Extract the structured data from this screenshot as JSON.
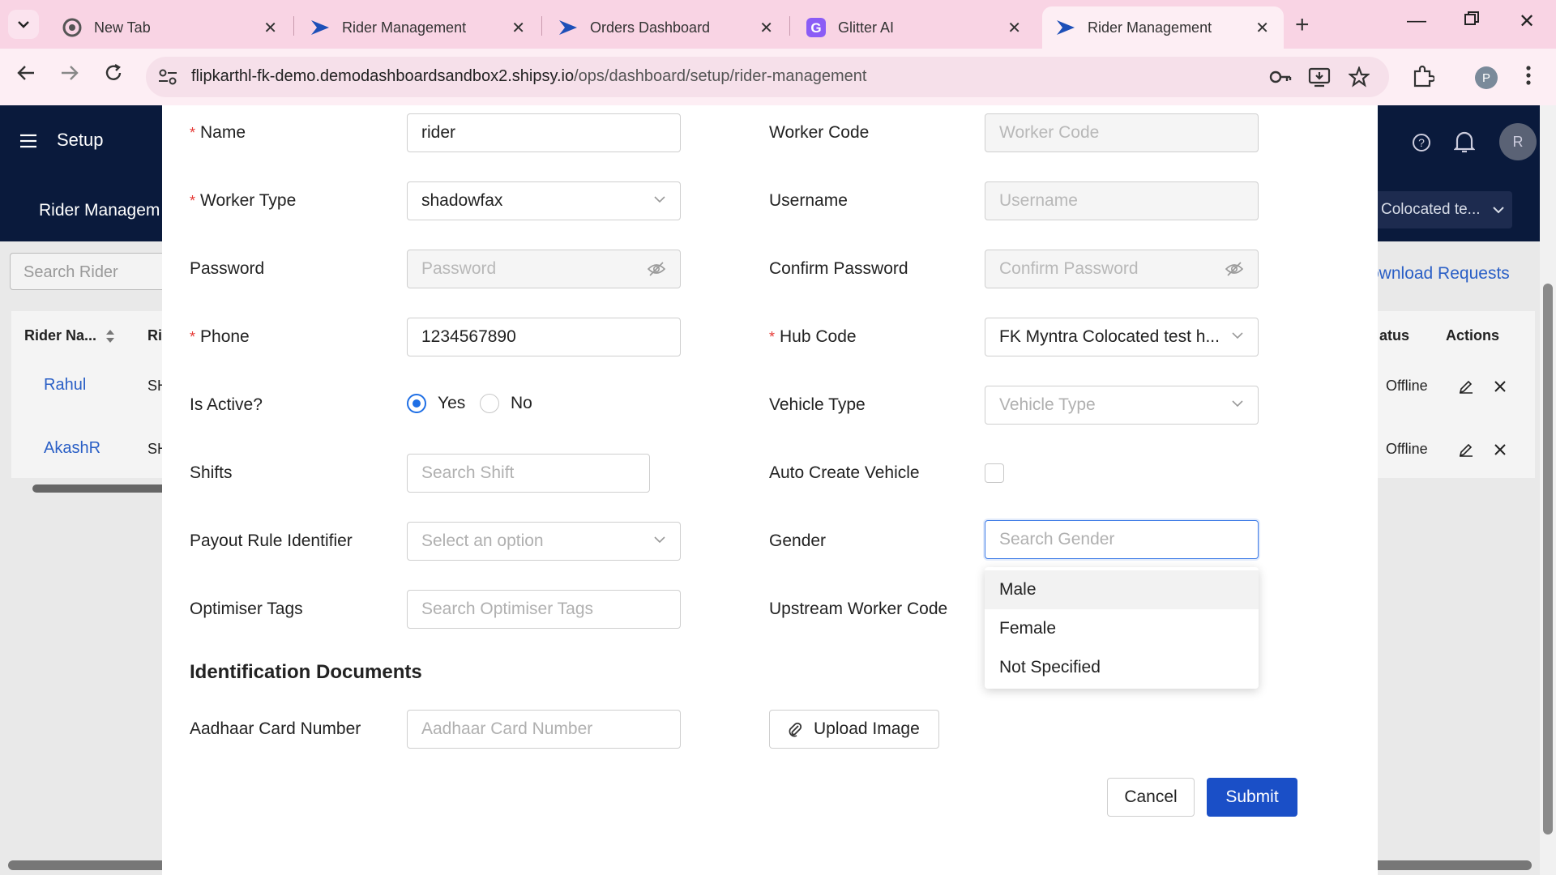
{
  "browser": {
    "tabs": [
      {
        "title": "New Tab",
        "icon": "chrome-icon"
      },
      {
        "title": "Rider Management",
        "icon": "shipsy-icon"
      },
      {
        "title": "Orders Dashboard",
        "icon": "shipsy-icon"
      },
      {
        "title": "Glitter AI",
        "icon": "glitter-icon"
      },
      {
        "title": "Rider Management",
        "icon": "shipsy-icon",
        "active": true
      }
    ],
    "url_host": "flipkarthl-fk-demo.demodashboardsandbox2.shipsy.io",
    "url_path": "/ops/dashboard/setup/rider-management",
    "profile_initial": "P"
  },
  "app": {
    "title": "Setup",
    "page": "Rider Managem",
    "avatar_initial": "R",
    "hub_select": "Colocated te...",
    "search_placeholder": "Search Rider",
    "download_link": "ownload Requests",
    "table": {
      "headers": {
        "name": "Rider Na...",
        "col2": "Ri",
        "status": "atus",
        "actions": "Actions"
      },
      "rows": [
        {
          "name": "Rahul",
          "col2": "SH",
          "status": "Offline"
        },
        {
          "name": "AkashR",
          "col2": "SH",
          "status": "Offline"
        }
      ]
    }
  },
  "form": {
    "name": {
      "label": "Name",
      "value": "rider"
    },
    "worker_code": {
      "label": "Worker Code",
      "placeholder": "Worker Code"
    },
    "worker_type": {
      "label": "Worker Type",
      "value": "shadowfax"
    },
    "username": {
      "label": "Username",
      "placeholder": "Username"
    },
    "password": {
      "label": "Password",
      "placeholder": "Password"
    },
    "confirm_password": {
      "label": "Confirm Password",
      "placeholder": "Confirm Password"
    },
    "phone": {
      "label": "Phone",
      "value": "1234567890"
    },
    "hub_code": {
      "label": "Hub Code",
      "value": "FK Myntra Colocated test h..."
    },
    "is_active": {
      "label": "Is Active?",
      "yes": "Yes",
      "no": "No",
      "selected": "Yes"
    },
    "vehicle_type": {
      "label": "Vehicle Type",
      "placeholder": "Vehicle Type"
    },
    "shifts": {
      "label": "Shifts",
      "placeholder": "Search Shift"
    },
    "auto_create_vehicle": {
      "label": "Auto Create Vehicle",
      "checked": false
    },
    "payout_rule": {
      "label": "Payout Rule Identifier",
      "placeholder": "Select an option"
    },
    "gender": {
      "label": "Gender",
      "placeholder": "Search Gender",
      "options": [
        "Male",
        "Female",
        "Not Specified"
      ]
    },
    "optimiser_tags": {
      "label": "Optimiser Tags",
      "placeholder": "Search Optimiser Tags"
    },
    "upstream_worker_code": {
      "label": "Upstream Worker Code"
    },
    "section_title": "Identification Documents",
    "aadhaar": {
      "label": "Aadhaar Card Number",
      "placeholder": "Aadhaar Card Number"
    },
    "upload_label": "Upload Image",
    "cancel_label": "Cancel",
    "submit_label": "Submit"
  },
  "colors": {
    "accent": "#1a4fc7",
    "required": "#e53935",
    "header": "#0a1a3c",
    "tabstrip": "#f9d4e4"
  }
}
